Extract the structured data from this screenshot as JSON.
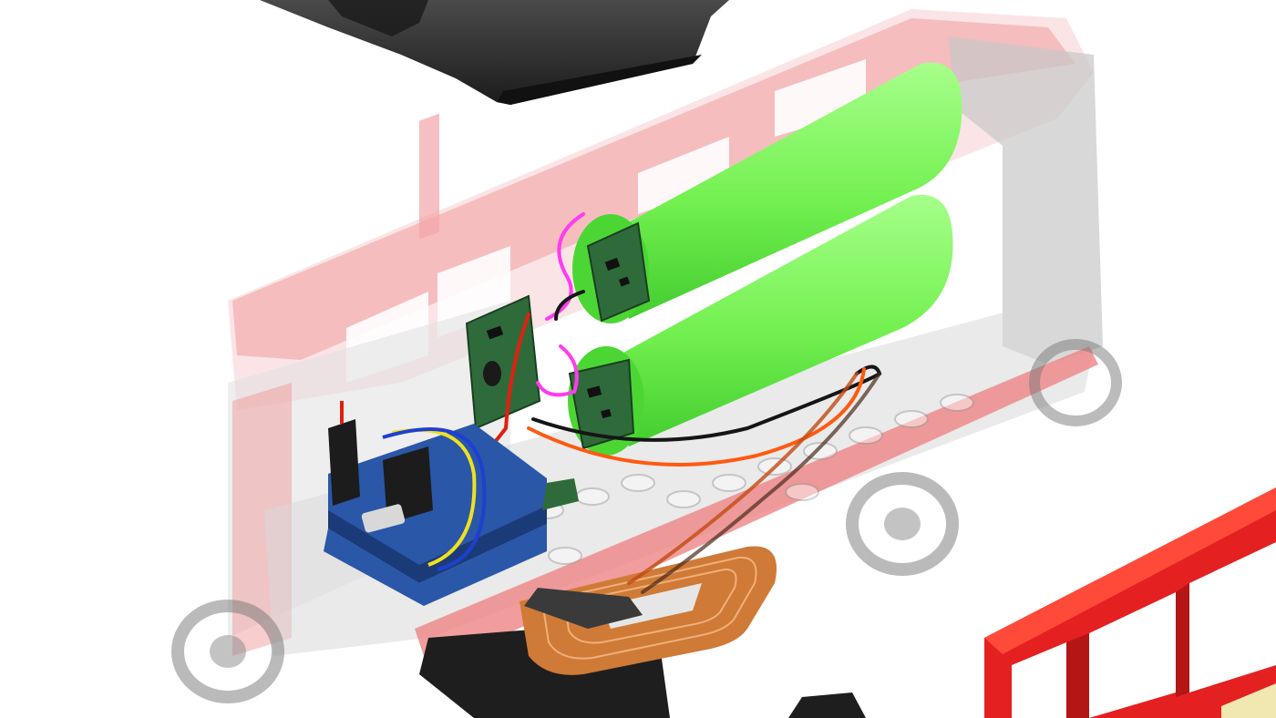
{
  "scene": {
    "background": "#ffffff",
    "colors": {
      "brick_red": "#e02020",
      "brick_red_ghost": "#e8565a",
      "ghost_gray": "#8a8a8a",
      "roof_black": "#2b2b2b",
      "battery_green": "#7cf55a",
      "battery_green_dark": "#3fd22e",
      "pcb_green": "#2f6b3a",
      "pcb_blue": "#2a57a8",
      "coil_copper": "#c8712f",
      "wire_red": "#e02010",
      "wire_black": "#151515",
      "wire_magenta": "#ff3cf0",
      "wire_yellow": "#f0e020",
      "wire_orange": "#ff5a10",
      "wire_blue": "#1f3fd0"
    },
    "components": {
      "batteries": 2,
      "battery_protection_boards": 2,
      "charger_board": 1,
      "controller_stack": 1,
      "wireless_charging_coil": 1
    }
  }
}
